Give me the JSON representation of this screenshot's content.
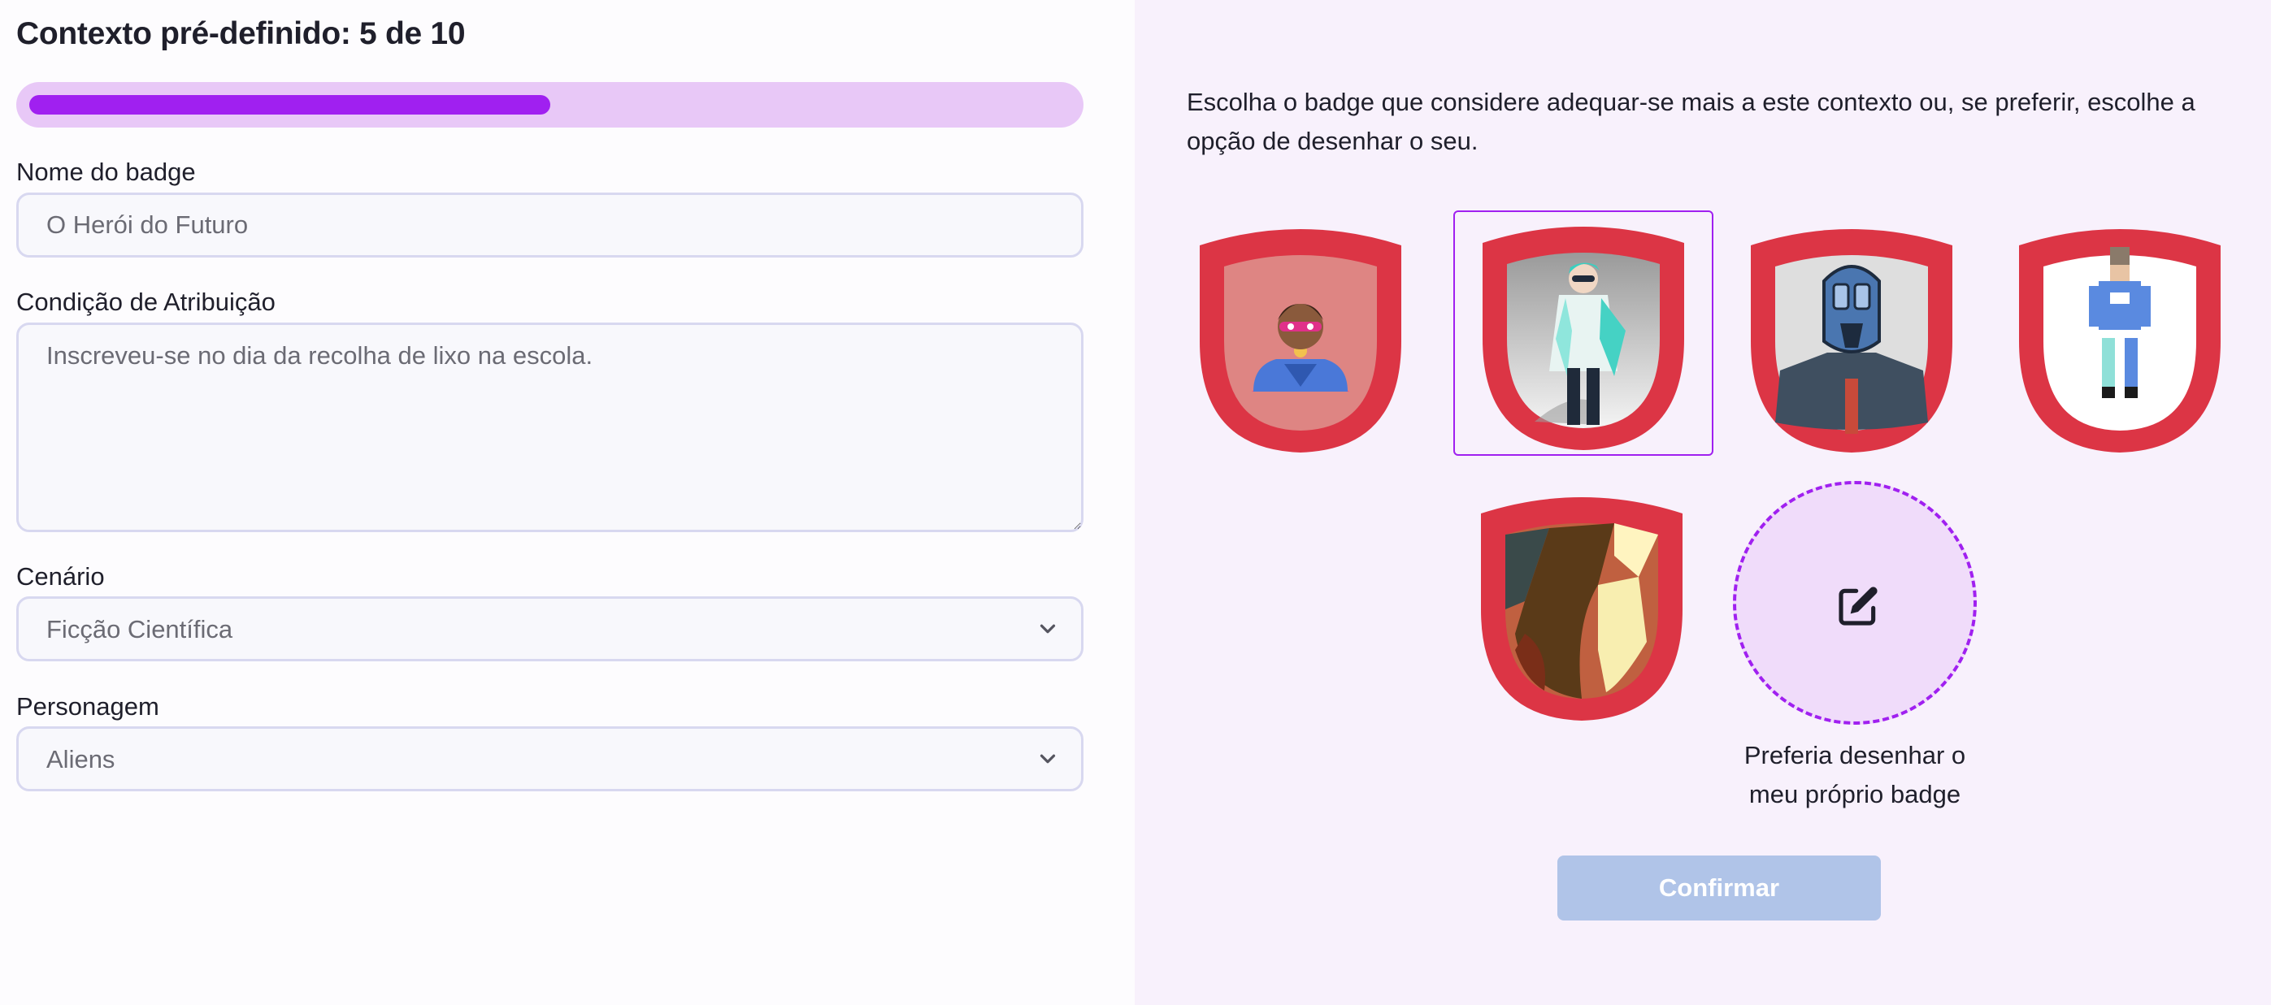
{
  "header": {
    "title": "Contexto pré-definido: 5 de 10"
  },
  "progress": {
    "current": 5,
    "total": 10,
    "fraction": 0.5
  },
  "form": {
    "badge_name": {
      "label": "Nome do badge",
      "placeholder": "O Herói do Futuro"
    },
    "condition": {
      "label": "Condição de Atribuição",
      "placeholder": "Inscreveu-se no dia da recolha de lixo na escola."
    },
    "scenario": {
      "label": "Cenário",
      "value": "Ficção Científica"
    },
    "character": {
      "label": "Personagem",
      "value": "Aliens"
    }
  },
  "picker": {
    "description": "Escolha o badge que considere adequar-se mais a este contexto ou, se preferir, escolhe a opção de desenhar o seu.",
    "badges": [
      {
        "icon": "superhero-badge-icon",
        "selected": false
      },
      {
        "icon": "scientist-badge-icon",
        "selected": true
      },
      {
        "icon": "robot-badge-icon",
        "selected": false
      },
      {
        "icon": "pixel-astronaut-badge-icon",
        "selected": false
      },
      {
        "icon": "abstract-badge-icon",
        "selected": false
      }
    ],
    "draw_option_label": "Preferia desenhar o meu próprio badge",
    "draw_icon": "edit-icon"
  },
  "actions": {
    "confirm_label": "Confirmar"
  },
  "colors": {
    "accent": "#a020f0",
    "badge_frame": "#dc3545",
    "confirm_disabled": "#b0c4e8",
    "right_panel_bg": "#f8f1fc"
  }
}
